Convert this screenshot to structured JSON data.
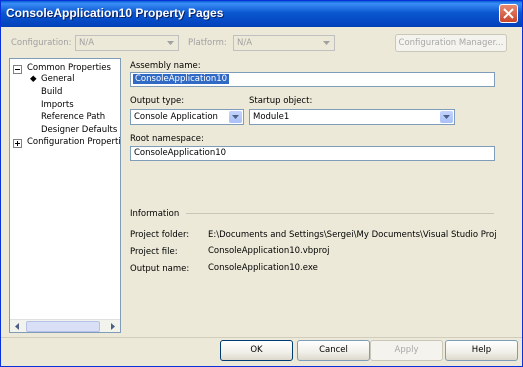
{
  "window": {
    "title": "ConsoleApplication10 Property Pages"
  },
  "toolbar": {
    "configuration_label": "Configuration:",
    "configuration_value": "N/A",
    "platform_label": "Platform:",
    "platform_value": "N/A",
    "config_manager_label": "Configuration Manager..."
  },
  "tree": {
    "items": [
      {
        "label": "Common Properties"
      },
      {
        "label": "General"
      },
      {
        "label": "Build"
      },
      {
        "label": "Imports"
      },
      {
        "label": "Reference Path"
      },
      {
        "label": "Designer Defaults"
      },
      {
        "label": "Configuration Properties"
      }
    ],
    "selected_marker": "◆"
  },
  "general": {
    "assembly_name_label": "Assembly name:",
    "assembly_name_value": "ConsoleApplication10",
    "output_type_label": "Output type:",
    "output_type_value": "Console Application",
    "startup_object_label": "Startup object:",
    "startup_object_value": "Module1",
    "root_namespace_label": "Root namespace:",
    "root_namespace_value": "ConsoleApplication10"
  },
  "information": {
    "section_label": "Information",
    "project_folder_label": "Project folder:",
    "project_folder_value": "E:\\Documents and Settings\\Sergei\\My Documents\\Visual Studio Proj",
    "project_file_label": "Project file:",
    "project_file_value": "ConsoleApplication10.vbproj",
    "output_name_label": "Output name:",
    "output_name_value": "ConsoleApplication10.exe"
  },
  "buttons": {
    "ok": "OK",
    "cancel": "Cancel",
    "apply": "Apply",
    "help": "Help"
  }
}
